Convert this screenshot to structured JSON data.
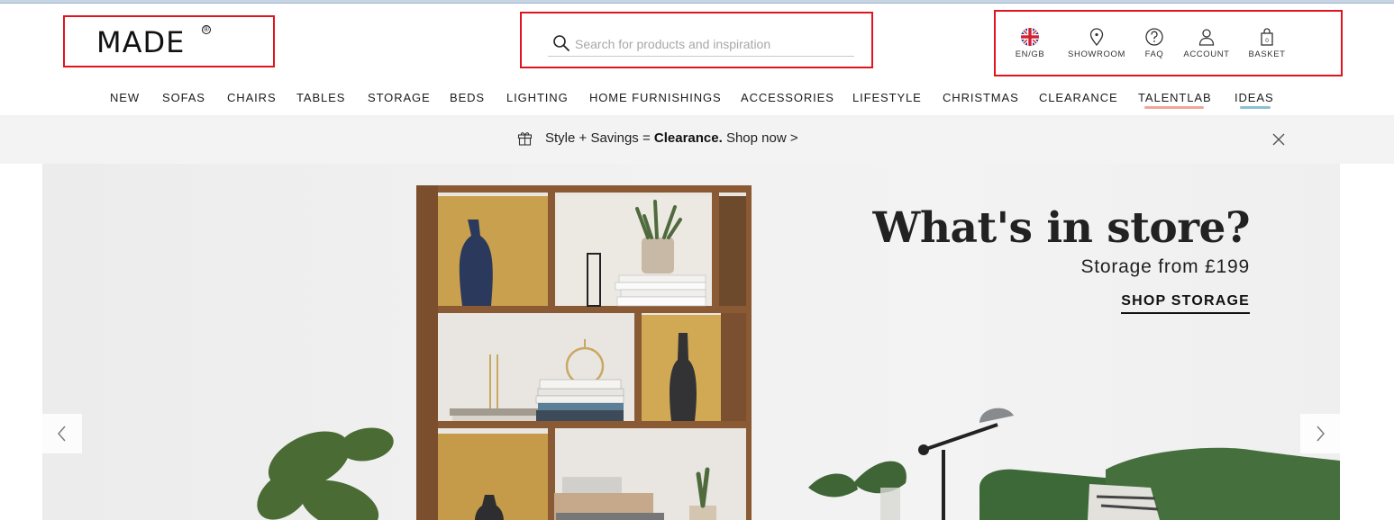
{
  "brand": {
    "logo_text": "MADE",
    "logo_mark": "®"
  },
  "search": {
    "placeholder": "Search for products and inspiration",
    "value": ""
  },
  "utility": [
    {
      "icon": "uk-flag-icon",
      "label": "EN/GB"
    },
    {
      "icon": "location-pin-icon",
      "label": "SHOWROOM"
    },
    {
      "icon": "question-circle-icon",
      "label": "FAQ"
    },
    {
      "icon": "user-icon",
      "label": "ACCOUNT"
    },
    {
      "icon": "shopping-bag-icon",
      "label": "BASKET",
      "count": "0"
    }
  ],
  "nav": [
    "NEW",
    "SOFAS",
    "CHAIRS",
    "TABLES",
    "STORAGE",
    "BEDS",
    "LIGHTING",
    "HOME FURNISHINGS",
    "ACCESSORIES",
    "LIFESTYLE",
    "CHRISTMAS",
    "CLEARANCE",
    "TALENTLAB",
    "IDEAS"
  ],
  "nav_accents": {
    "TALENTLAB": "#f0a59a",
    "IDEAS": "#8cc0d0"
  },
  "promo": {
    "icon": "gift-icon",
    "prefix": "Style + Savings = ",
    "bold": "Clearance.",
    "suffix": " Shop now >",
    "close_icon": "close-icon"
  },
  "hero": {
    "title": "What's in store?",
    "subtitle": "Storage from £199",
    "cta": "SHOP STORAGE",
    "prev_icon": "chevron-left-icon",
    "next_icon": "chevron-right-icon"
  },
  "colors": {
    "annotation": "#e0141c",
    "promo_bg": "#f3f3f3",
    "sofa_green": "#3f6a3a"
  }
}
